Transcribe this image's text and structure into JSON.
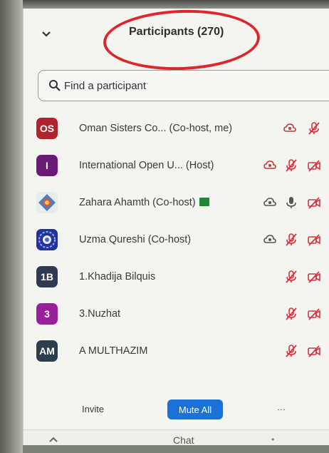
{
  "header": {
    "title": "Participants (270)",
    "annotation_color": "#e0262d"
  },
  "search": {
    "placeholder": "Find a participant"
  },
  "participants": [
    {
      "initials": "OS",
      "avatar_color": "#b0222c",
      "name": "Oman Sisters Co...  (Co-host, me)",
      "icons": [
        "cloud-icon",
        "mic-muted-icon"
      ]
    },
    {
      "initials": "I",
      "avatar_color": "#6b1a78",
      "name": "International Open U...  (Host)",
      "icons": [
        "cloud-icon",
        "mic-muted-icon",
        "video-off-icon"
      ]
    },
    {
      "initials": "",
      "avatar_type": "photo",
      "name": "Zahara Ahamth (Co-host)",
      "icons": [
        "screen-share-badge",
        "cloud-icon",
        "mic-icon",
        "video-off-icon"
      ]
    },
    {
      "initials": "",
      "avatar_type": "pattern",
      "name": "Uzma Qureshi (Co-host)",
      "icons": [
        "cloud-icon",
        "mic-muted-icon",
        "video-off-icon"
      ]
    },
    {
      "initials": "1B",
      "avatar_color": "#2f3a52",
      "name": "1.Khadija Bilquis",
      "icons": [
        "mic-muted-icon",
        "video-off-icon"
      ]
    },
    {
      "initials": "3",
      "avatar_color": "#9a1f9a",
      "name": "3.Nuzhat",
      "icons": [
        "mic-muted-icon",
        "video-off-icon"
      ]
    },
    {
      "initials": "AM",
      "avatar_color": "#2c3d4e",
      "name": "A MULTHAZIM",
      "icons": [
        "mic-muted-icon",
        "video-off-icon"
      ]
    }
  ],
  "footer": {
    "invite_label": "Invite",
    "mute_all_label": "Mute All",
    "more_label": "...",
    "mute_all_color": "#1a72d9"
  },
  "bottom_bar": {
    "chat_label": "Chat"
  },
  "colors": {
    "muted_red": "#d8323a"
  }
}
